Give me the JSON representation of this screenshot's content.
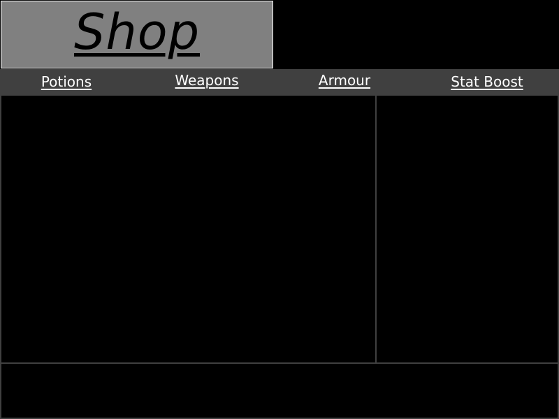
{
  "shop": {
    "title": "Shop"
  },
  "tabs": [
    {
      "label": "Potions"
    },
    {
      "label": "Weapons"
    },
    {
      "label": "Armour"
    },
    {
      "label": "Stat Boost"
    }
  ],
  "colors": {
    "background": "#000000",
    "title_box": "#808080",
    "tab_bar": "#404040",
    "panel_border": "#404040",
    "tab_text": "#ffffff"
  }
}
